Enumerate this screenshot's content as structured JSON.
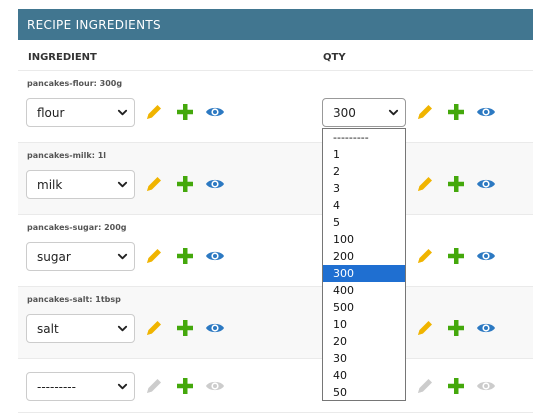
{
  "caption": "RECIPE INGREDIENTS",
  "columns": {
    "ingredient": "INGREDIENT",
    "qty": "QTY"
  },
  "rows": [
    {
      "label": "pancakes-flour: 300g",
      "ingredient": "flour",
      "qty": "300"
    },
    {
      "label": "pancakes-milk: 1l",
      "ingredient": "milk",
      "qty": ""
    },
    {
      "label": "pancakes-sugar: 200g",
      "ingredient": "sugar",
      "qty": ""
    },
    {
      "label": "pancakes-salt: 1tbsp",
      "ingredient": "salt",
      "qty": ""
    },
    {
      "label": "",
      "ingredient": "---------",
      "qty": ""
    }
  ],
  "qty_dropdown": {
    "selected": "300",
    "options": [
      "---------",
      "1",
      "2",
      "3",
      "4",
      "5",
      "100",
      "200",
      "300",
      "400",
      "500",
      "10",
      "20",
      "30",
      "40",
      "50"
    ]
  },
  "colors": {
    "header": "#417690",
    "edit": "#f0b400",
    "add": "#44a80c",
    "view": "#2c79c2",
    "disabled": "#cccccc",
    "selected_option": "#1f6fd1"
  },
  "icons": {
    "edit": "pencil-icon",
    "add": "plus-icon",
    "view": "eye-icon",
    "dropdown": "chevron-down-icon"
  }
}
